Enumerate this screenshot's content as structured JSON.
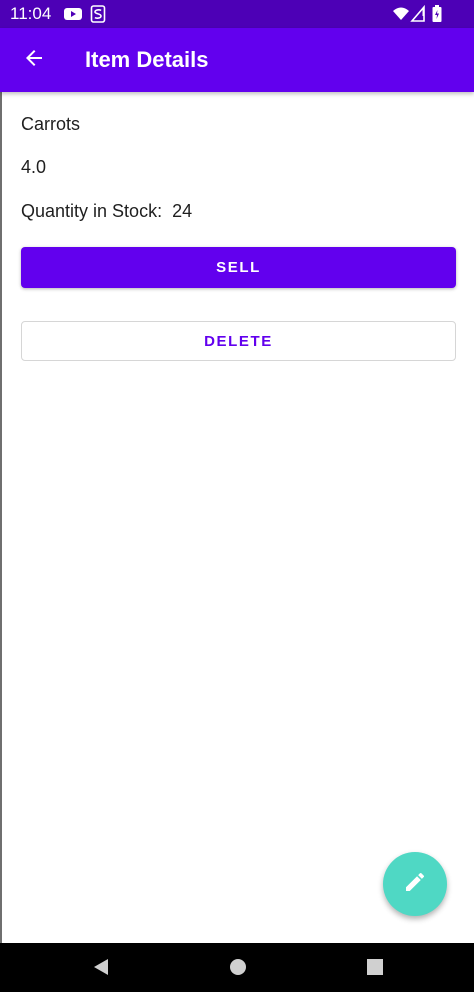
{
  "status_bar": {
    "time": "11:04",
    "icons_left": [
      "youtube-icon",
      "s-app-icon"
    ],
    "icons_right": [
      "wifi-icon",
      "signal-icon",
      "battery-icon"
    ],
    "background": "#4d00b6"
  },
  "app_bar": {
    "title": "Item Details",
    "back_icon": "arrow-back-icon",
    "background": "#6200ee"
  },
  "item": {
    "name": "Carrots",
    "price": "4.0",
    "quantity_label": "Quantity in Stock:",
    "quantity_value": "24"
  },
  "actions": {
    "sell_label": "SELL",
    "delete_label": "DELETE"
  },
  "fab": {
    "icon": "edit-pencil-icon",
    "color": "#4fd8c4"
  },
  "nav_bar": {
    "buttons": [
      "back-triangle-icon",
      "home-circle-icon",
      "recents-square-icon"
    ]
  },
  "colors": {
    "primary": "#6200ee",
    "primary_dark": "#4d00b6",
    "accent": "#4fd8c4"
  }
}
